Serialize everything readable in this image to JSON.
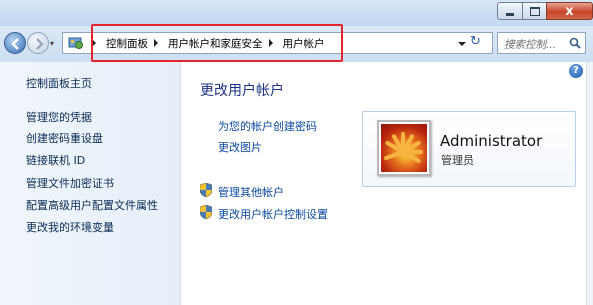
{
  "window": {
    "caption_close": "x"
  },
  "nav": {
    "recent_glyph": "▾",
    "breadcrumb": [
      "控制面板",
      "用户帐户和家庭安全",
      "用户帐户"
    ],
    "refresh_glyph": "↻",
    "search_placeholder": "搜索控制..."
  },
  "sidebar": {
    "items": [
      "控制面板主页",
      "管理您的凭据",
      "创建密码重设盘",
      "链接联机 ID",
      "管理文件加密证书",
      "配置高级用户配置文件属性",
      "更改我的环境变量"
    ]
  },
  "main": {
    "title": "更改用户帐户",
    "links": [
      "为您的帐户创建密码",
      "更改图片"
    ],
    "shield_links": [
      "管理其他帐户",
      "更改用户帐户控制设置"
    ],
    "help_glyph": "?"
  },
  "account": {
    "name": "Administrator",
    "role": "管理员"
  },
  "colors": {
    "highlight_box": "#e1262e",
    "link": "#0b49a0",
    "title": "#1e3287"
  }
}
